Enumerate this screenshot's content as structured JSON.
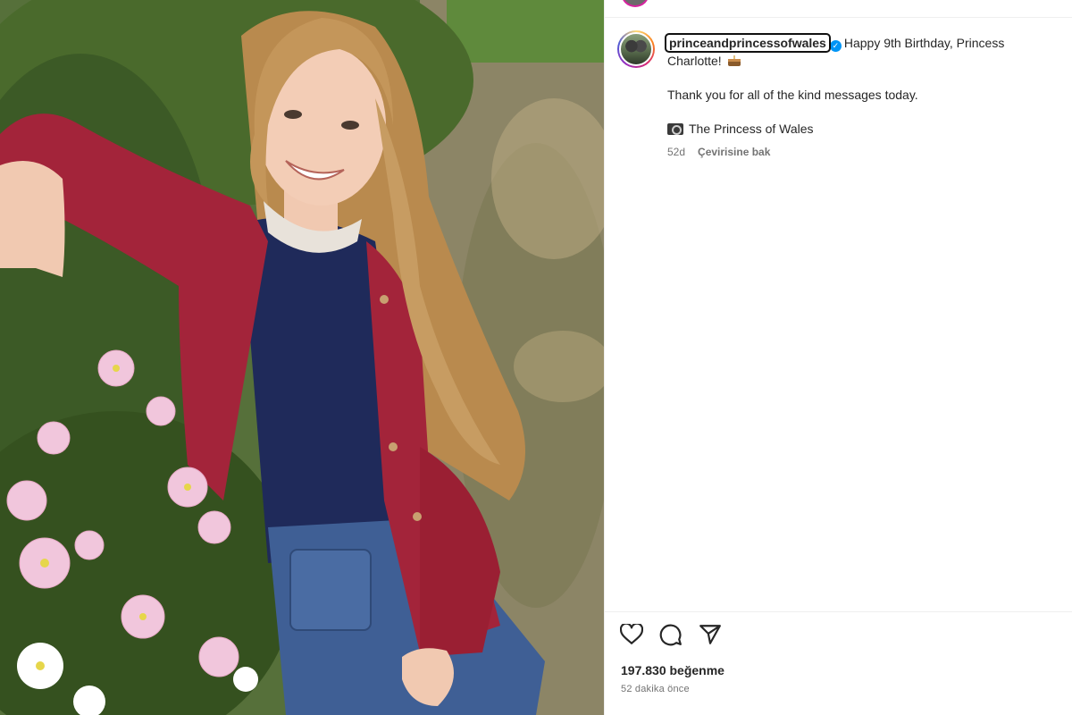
{
  "post": {
    "username": "princeandprincessofwales",
    "verified_icon": "verified-badge-icon",
    "caption_line1": "Happy 9th Birthday, Princess Charlotte!",
    "caption_emoji": "cake-icon",
    "caption_line2": "Thank you for all of the kind messages today.",
    "credit_icon": "camera-icon",
    "credit_text": "The Princess of Wales",
    "comment_age": "52d",
    "translate_label": "Çevirisine bak",
    "likes": "197.830 beğenme",
    "timestamp": "52 dakika önce"
  },
  "actions": {
    "like_icon": "heart-icon",
    "comment_icon": "comment-icon",
    "share_icon": "share-icon"
  },
  "colors": {
    "verified": "#0095f6",
    "text_primary": "#262626",
    "text_secondary": "#737373",
    "cardigan": "#a3243a",
    "sweater": "#1f2a5a",
    "skirt": "#3f5f95"
  }
}
